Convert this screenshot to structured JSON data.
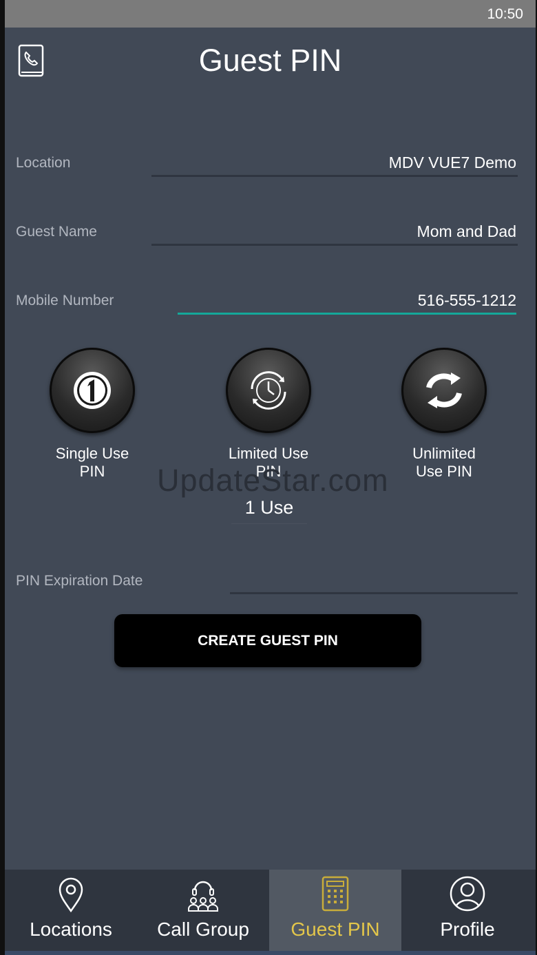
{
  "status_bar": {
    "time": "10:50"
  },
  "header": {
    "title": "Guest PIN",
    "icon": "phone-book-icon"
  },
  "form": {
    "location": {
      "label": "Location",
      "value": "MDV VUE7 Demo"
    },
    "guest_name": {
      "label": "Guest Name",
      "value": "Mom and Dad"
    },
    "mobile_number": {
      "label": "Mobile Number",
      "value": "516-555-1212"
    },
    "pin_expiration": {
      "label": "PIN Expiration Date",
      "value": ""
    }
  },
  "pin_types": [
    {
      "line1": "Single Use",
      "line2": "PIN",
      "icon": "single-use-icon"
    },
    {
      "line1": "Limited Use",
      "line2": "PIN",
      "icon": "clock-icon"
    },
    {
      "line1": "Unlimited",
      "line2": "Use PIN",
      "icon": "refresh-icon"
    }
  ],
  "uses": {
    "value": "1 Use"
  },
  "watermark": "UpdateStar.com",
  "create_button": {
    "label": "CREATE GUEST PIN"
  },
  "nav": {
    "items": [
      {
        "label": "Locations",
        "icon": "location-pin-icon"
      },
      {
        "label": "Call Group",
        "icon": "call-group-icon"
      },
      {
        "label": "Guest PIN",
        "icon": "keypad-icon",
        "active": true
      },
      {
        "label": "Profile",
        "icon": "profile-icon"
      }
    ]
  },
  "colors": {
    "background": "#414956",
    "accent_underline": "#14a89a",
    "active_nav_label": "#e3c64a"
  }
}
